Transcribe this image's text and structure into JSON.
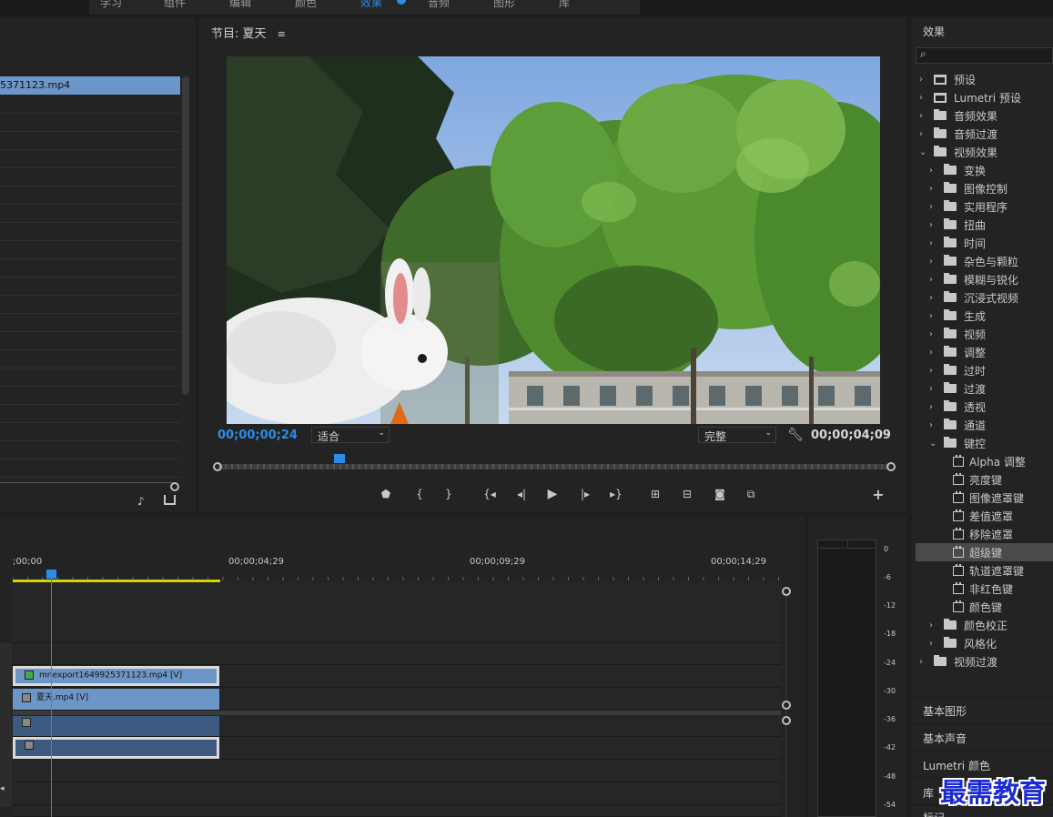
{
  "topbar": {
    "tabs": [
      "学习",
      "组件",
      "编辑",
      "颜色",
      "效果",
      "音频",
      "图形",
      "库"
    ],
    "active_index": 4
  },
  "project": {
    "selected_file": "5371123.mp4"
  },
  "program": {
    "title": "节目: 夏天",
    "current_timecode": "00;00;00;24",
    "fit_option": "适合",
    "quality_option": "完整",
    "duration_timecode": "00;00;04;09",
    "playhead_fraction": 0.18
  },
  "timeline": {
    "ruler_labels": [
      ";00;00",
      "00;00;04;29",
      "00;00;09;29",
      "00;00;14;29"
    ],
    "clips": [
      {
        "name": "mnexport1649925371123.mp4 [V]"
      },
      {
        "name": "夏天.mp4 [V]"
      },
      {
        "name": ""
      },
      {
        "name": ""
      }
    ]
  },
  "meter": {
    "db_labels": [
      "0",
      "-6",
      "-12",
      "-18",
      "-24",
      "-30",
      "-36",
      "-42",
      "-48",
      "-54"
    ]
  },
  "effects": {
    "title": "效果",
    "search_placeholder": "",
    "items": [
      {
        "label": "预设",
        "type": "preset",
        "level": 0,
        "expanded": false
      },
      {
        "label": "Lumetri 预设",
        "type": "preset",
        "level": 0,
        "expanded": false
      },
      {
        "label": "音频效果",
        "type": "folder",
        "level": 0,
        "expanded": false
      },
      {
        "label": "音频过渡",
        "type": "folder",
        "level": 0,
        "expanded": false
      },
      {
        "label": "视频效果",
        "type": "folder",
        "level": 0,
        "expanded": true
      },
      {
        "label": "变换",
        "type": "folder",
        "level": 1,
        "expanded": false
      },
      {
        "label": "图像控制",
        "type": "folder",
        "level": 1,
        "expanded": false
      },
      {
        "label": "实用程序",
        "type": "folder",
        "level": 1,
        "expanded": false
      },
      {
        "label": "扭曲",
        "type": "folder",
        "level": 1,
        "expanded": false
      },
      {
        "label": "时间",
        "type": "folder",
        "level": 1,
        "expanded": false
      },
      {
        "label": "杂色与颗粒",
        "type": "folder",
        "level": 1,
        "expanded": false
      },
      {
        "label": "模糊与锐化",
        "type": "folder",
        "level": 1,
        "expanded": false
      },
      {
        "label": "沉浸式视频",
        "type": "folder",
        "level": 1,
        "expanded": false
      },
      {
        "label": "生成",
        "type": "folder",
        "level": 1,
        "expanded": false
      },
      {
        "label": "视频",
        "type": "folder",
        "level": 1,
        "expanded": false
      },
      {
        "label": "调整",
        "type": "folder",
        "level": 1,
        "expanded": false
      },
      {
        "label": "过时",
        "type": "folder",
        "level": 1,
        "expanded": false
      },
      {
        "label": "过渡",
        "type": "folder",
        "level": 1,
        "expanded": false
      },
      {
        "label": "透视",
        "type": "folder",
        "level": 1,
        "expanded": false
      },
      {
        "label": "通道",
        "type": "folder",
        "level": 1,
        "expanded": false
      },
      {
        "label": "键控",
        "type": "folder",
        "level": 1,
        "expanded": true
      },
      {
        "label": "Alpha 调整",
        "type": "effect",
        "level": 2
      },
      {
        "label": "亮度键",
        "type": "effect",
        "level": 2
      },
      {
        "label": "图像遮罩键",
        "type": "effect",
        "level": 2
      },
      {
        "label": "差值遮罩",
        "type": "effect",
        "level": 2
      },
      {
        "label": "移除遮罩",
        "type": "effect",
        "level": 2
      },
      {
        "label": "超级键",
        "type": "effect",
        "level": 2,
        "selected": true
      },
      {
        "label": "轨道遮罩键",
        "type": "effect",
        "level": 2
      },
      {
        "label": "非红色键",
        "type": "effect",
        "level": 2
      },
      {
        "label": "颜色键",
        "type": "effect",
        "level": 2
      },
      {
        "label": "颜色校正",
        "type": "folder",
        "level": 1,
        "expanded": false
      },
      {
        "label": "风格化",
        "type": "folder",
        "level": 1,
        "expanded": false
      },
      {
        "label": "视频过渡",
        "type": "folder",
        "level": 0,
        "expanded": false
      }
    ]
  },
  "side_panels": [
    "基本图形",
    "基本声音",
    "Lumetri 颜色",
    "库",
    "标记"
  ],
  "watermark": "最需教育",
  "colors": {
    "accent": "#2d8ceb",
    "clip_video": "#6d96c8",
    "workarea": "#d4d400"
  }
}
